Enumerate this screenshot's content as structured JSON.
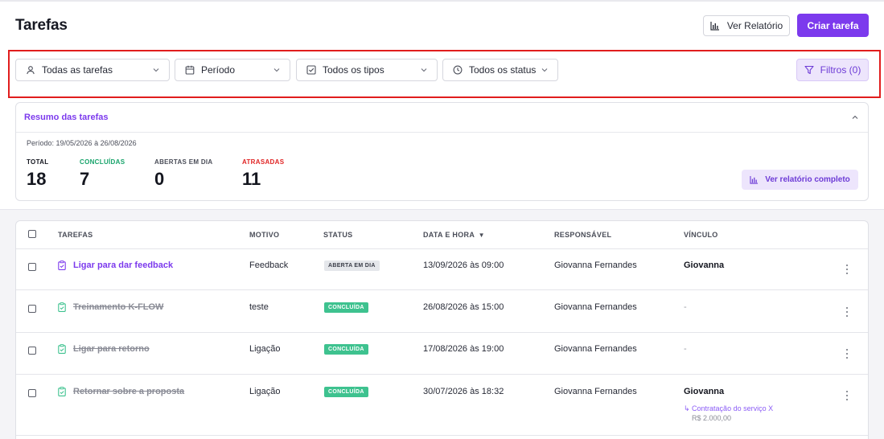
{
  "header": {
    "title": "Tarefas",
    "report_label": "Ver Relatório",
    "create_label": "Criar tarefa"
  },
  "filters": {
    "assignee": "Todas as tarefas",
    "period": "Período",
    "types": "Todos os tipos",
    "status": "Todos os status",
    "filters_label": "Filtros (0)"
  },
  "summary": {
    "title": "Resumo das tarefas",
    "period_text": "Período: 19/05/2026 à 26/08/2026",
    "stats": [
      {
        "label": "TOTAL",
        "value": "18",
        "color": "#14161f"
      },
      {
        "label": "CONCLUÍDAS",
        "value": "7",
        "color": "#16a36a"
      },
      {
        "label": "ABERTAS EM DIA",
        "value": "0",
        "color": "#4a4d58"
      },
      {
        "label": "ATRASADAS",
        "value": "11",
        "color": "#e02424"
      }
    ],
    "full_report_label": "Ver relatório completo"
  },
  "table": {
    "columns": {
      "tasks": "TAREFAS",
      "reason": "MOTIVO",
      "status": "STATUS",
      "datetime": "DATA E HORA",
      "responsible": "RESPONSÁVEL",
      "link": "VÍNCULO"
    },
    "sort_indicator": "▼",
    "rows": [
      {
        "name": "Ligar para dar feedback",
        "reason": "Feedback",
        "status": "ABERTA EM DIA",
        "datetime": "13/09/2026 às 09:00",
        "responsible": "Giovanna Fernandes",
        "link": "Giovanna"
      },
      {
        "name": "Treinamento K-FLOW",
        "reason": "teste",
        "status": "CONCLUÍDA",
        "datetime": "26/08/2026 às 15:00",
        "responsible": "Giovanna Fernandes",
        "link": "-"
      },
      {
        "name": "Ligar para retorno",
        "reason": "Ligação",
        "status": "CONCLUÍDA",
        "datetime": "17/08/2026 às 19:00",
        "responsible": "Giovanna Fernandes",
        "link": "-"
      },
      {
        "name": "Retornar sobre a proposta",
        "reason": "Ligação",
        "status": "CONCLUÍDA",
        "datetime": "30/07/2026 às 18:32",
        "responsible": "Giovanna Fernandes",
        "link": "Giovanna",
        "link_detail": "↳ Contratação do serviço X",
        "link_value": "R$ 2.000,00"
      }
    ]
  },
  "colors": {
    "accent": "#7c3aed",
    "done_badge": "#3ec28f",
    "highlight_border": "#e11d1d"
  },
  "icons": [
    "bar-chart-icon",
    "user-icon",
    "calendar-icon",
    "checkbox-icon",
    "clock-icon",
    "filter-icon",
    "chevron-down-icon",
    "chevron-up-icon",
    "task-clipboard-icon",
    "kebab-menu-icon"
  ]
}
